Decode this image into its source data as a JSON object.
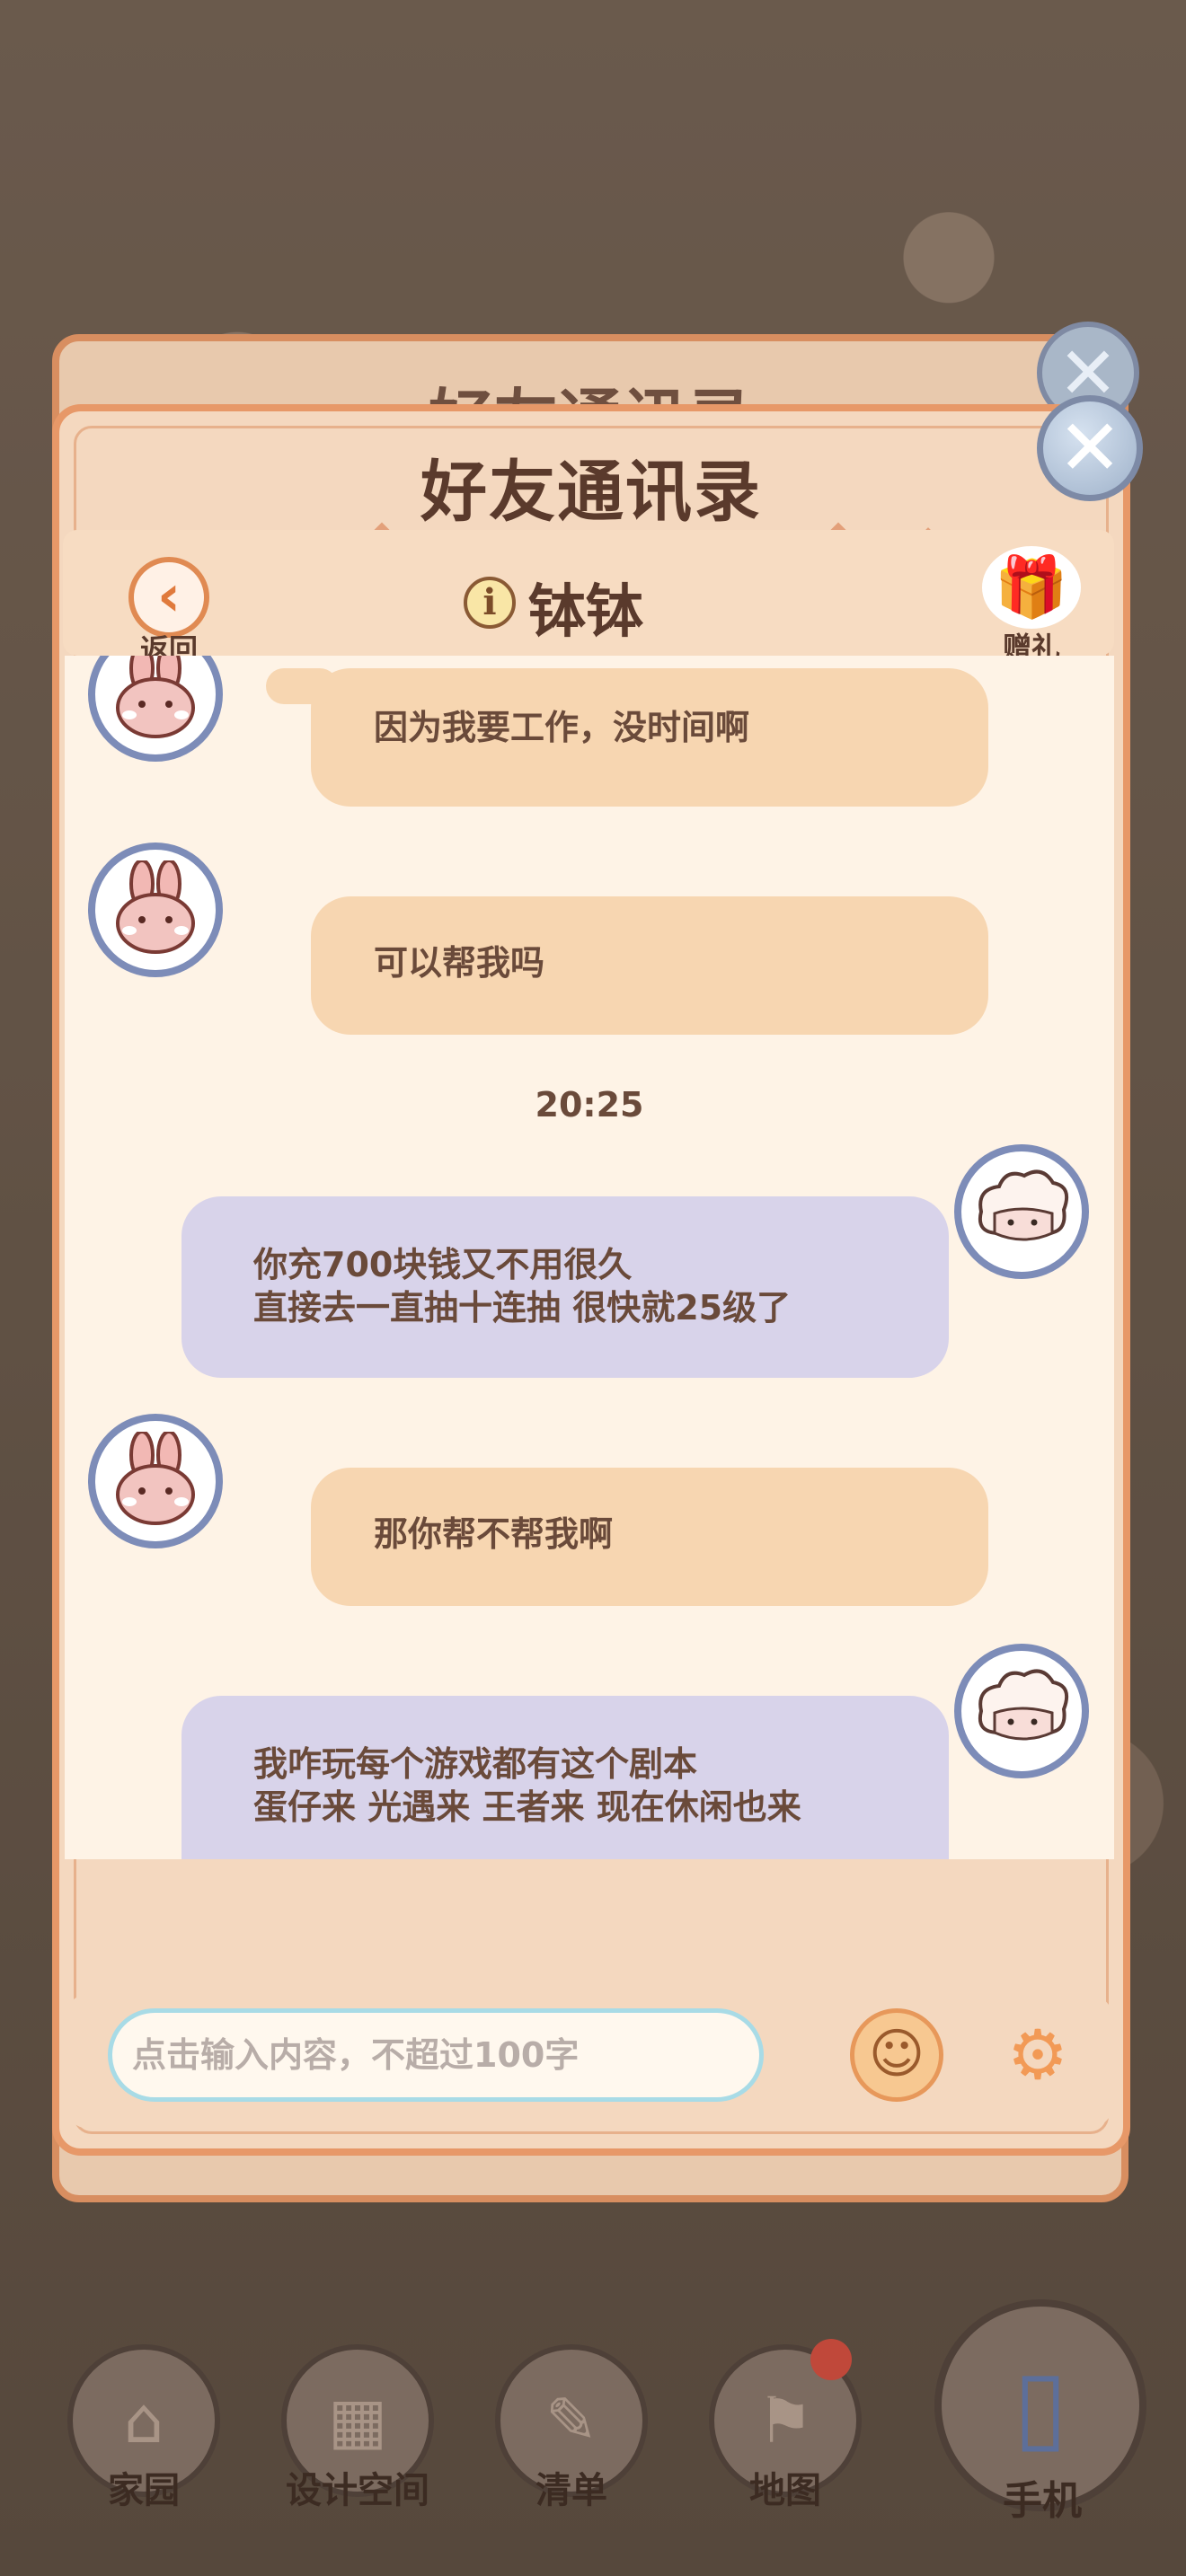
{
  "dialog_title": "好友通讯录",
  "header": {
    "back_label": "返回",
    "back_glyph": "‹",
    "info_glyph": "i",
    "friend_name": "钵钵",
    "gift_label": "赠礼",
    "gift_glyph": "🎁"
  },
  "close_glyph": "✕",
  "messages": [
    {
      "sender": "friend",
      "text": "因为我要工作，没时间啊"
    },
    {
      "sender": "friend",
      "text": "可以帮我吗"
    },
    {
      "timestamp": "20:25"
    },
    {
      "sender": "me",
      "lines": [
        "你充700块钱又不用很久",
        "直接去一直抽十连抽 很快就25级了"
      ]
    },
    {
      "sender": "friend",
      "text": "那你帮不帮我啊"
    },
    {
      "sender": "me",
      "lines": [
        "我咋玩每个游戏都有这个剧本",
        "蛋仔来 光遇来 王者来 现在休闲也来"
      ]
    }
  ],
  "input": {
    "placeholder": "点击输入内容，不超过100字",
    "emoji_glyph": "☺",
    "settings_glyph": "⚙"
  },
  "bottom_nav": [
    {
      "label": "家园",
      "glyph": "⌂"
    },
    {
      "label": "设计空间",
      "glyph": "▦"
    },
    {
      "label": "清单",
      "glyph": "✎"
    },
    {
      "label": "地图",
      "glyph": "⚑"
    },
    {
      "label": "手机",
      "glyph": "▯"
    }
  ],
  "avatars": {
    "friend": "bunny",
    "me": "sheep"
  },
  "colors": {
    "friend_bubble": "#f7d6b1",
    "me_bubble": "#d8d3ea",
    "accent": "#e79868",
    "text": "#5a3a2c"
  }
}
